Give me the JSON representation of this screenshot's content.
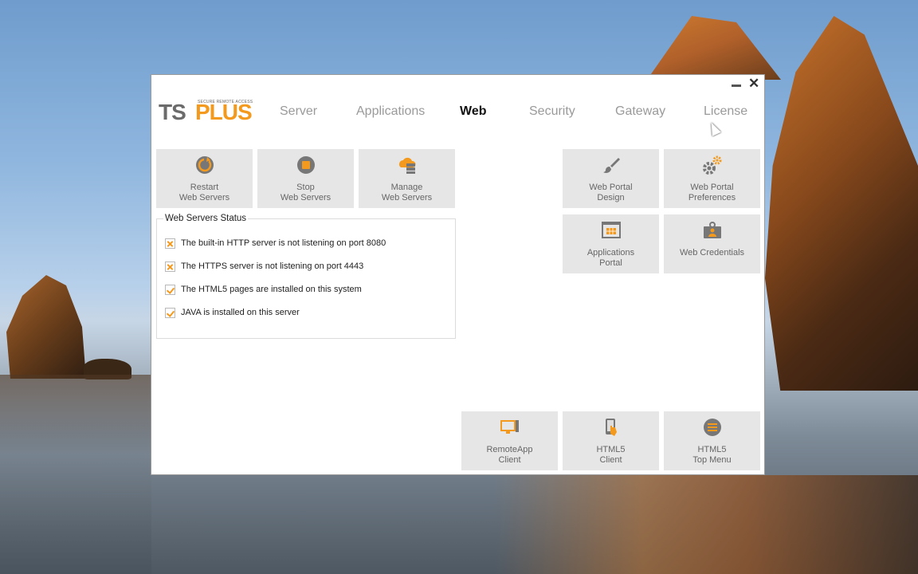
{
  "window": {
    "logo": {
      "ts": "TS",
      "plus": "PLUS",
      "tagline": "SECURE REMOTE ACCESS"
    },
    "tabs": [
      {
        "label": "Server",
        "active": false
      },
      {
        "label": "Applications",
        "active": false
      },
      {
        "label": "Web",
        "active": true
      },
      {
        "label": "Security",
        "active": false
      },
      {
        "label": "Gateway",
        "active": false
      },
      {
        "label": "License",
        "active": false
      }
    ]
  },
  "tiles": {
    "restart": {
      "line1": "Restart",
      "line2": "Web Servers",
      "icon": "restart-icon"
    },
    "stop": {
      "line1": "Stop",
      "line2": "Web Servers",
      "icon": "stop-icon"
    },
    "manage": {
      "line1": "Manage",
      "line2": "Web Servers",
      "icon": "cloud-server-icon"
    },
    "portal_design": {
      "line1": "Web Portal",
      "line2": "Design",
      "icon": "paintbrush-icon"
    },
    "portal_prefs": {
      "line1": "Web Portal",
      "line2": "Preferences",
      "icon": "gears-icon"
    },
    "apps_portal": {
      "line1": "Applications",
      "line2": "Portal",
      "icon": "app-grid-window-icon"
    },
    "web_credentials": {
      "line1": "Web Credentials",
      "line2": "",
      "icon": "id-badge-icon"
    },
    "remoteapp_client": {
      "line1": "RemoteApp",
      "line2": "Client",
      "icon": "monitor-icon"
    },
    "html5_client": {
      "line1": "HTML5",
      "line2": "Client",
      "icon": "touch-phone-icon"
    },
    "html5_top_menu": {
      "line1": "HTML5",
      "line2": "Top Menu",
      "icon": "menu-circle-icon"
    }
  },
  "status": {
    "title": "Web Servers Status",
    "items": [
      {
        "text": "The built-in HTTP server is not listening on port 8080",
        "state": "error"
      },
      {
        "text": "The HTTPS server is not listening on port 4443",
        "state": "error"
      },
      {
        "text": "The HTML5 pages are installed on this system",
        "state": "ok"
      },
      {
        "text": "JAVA is installed on this server",
        "state": "ok"
      }
    ]
  },
  "colors": {
    "accent": "#f39a1e",
    "tile_bg": "#e6e6e6",
    "icon_gray": "#7a7a7a"
  }
}
